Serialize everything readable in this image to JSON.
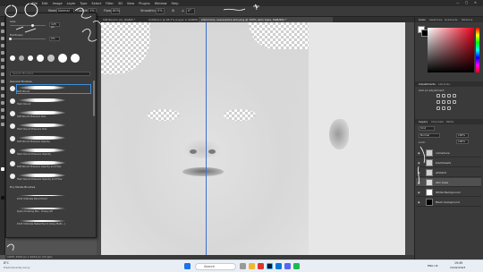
{
  "menu": [
    "File",
    "Edit",
    "Image",
    "Layer",
    "Type",
    "Select",
    "Filter",
    "3D",
    "View",
    "Plugins",
    "Window",
    "Help"
  ],
  "window_controls": [
    "—",
    "□",
    "✕"
  ],
  "options_bar": {
    "mode_label": "Mode:",
    "mode_value": "Normal",
    "opacity_label": "Opacity:",
    "opacity_value": "1%",
    "flow_label": "Flow:",
    "flow_value": "60%",
    "smoothing_label": "Smoothing:",
    "smoothing_value": "0%",
    "angle_value": "0°"
  },
  "doc_tabs": [
    {
      "label": "SIM Boom1 (C), RGB/8 *"
    },
    {
      "label": "Untitled-1 @ 66,7% (Layer 2, RGB/8) *"
    },
    {
      "label": "shimmerly overexplore skin.png @ 100% (skin base, RGB/8#) *"
    }
  ],
  "brush_panel": {
    "size_label": "Size:",
    "size_value": "125 px",
    "hardness_label": "Hardness:",
    "hardness_value": "0%",
    "search_placeholder": "Search Brushes",
    "general_header": "General Brushes",
    "brushes": [
      {
        "name": "Soft Round"
      },
      {
        "name": "Hard Round"
      },
      {
        "name": "Soft Round Pressure Size"
      },
      {
        "name": "Hard Round Pressure Size"
      },
      {
        "name": "Soft Round Pressure Opacity"
      },
      {
        "name": "Hard Round Pressure Opacity"
      },
      {
        "name": "Soft Round Pressure Opacity and Flow"
      },
      {
        "name": "Hard Round Pressure Opacity and Flow"
      }
    ],
    "dry_header": "Dry Media Brushes",
    "dry_brushes": [
      {
        "name": "KYLE Ultimate Pencil Hard"
      },
      {
        "name": "Kyle's Drawing Box - Heavy Gfl"
      },
      {
        "name": "KYLE Ultimate Pastel Pencil (Grey Multi...)"
      }
    ]
  },
  "status_bar": "100%   1024 px x 1024 px (72 ppi)",
  "right_panels": {
    "color_tabs": [
      "Color",
      "Swatches",
      "Gradients",
      "Patterns"
    ],
    "adjust_tabs": [
      "Adjustments",
      "Libraries"
    ],
    "adjust_label": "Add an adjustment",
    "layers_tabs": [
      "Layers",
      "Channels",
      "Paths"
    ],
    "kind_label": "Kind",
    "blend_mode": "Normal",
    "opacity_value": "100%",
    "lock_label": "Lock:",
    "fill_value": "100%",
    "layers": [
      {
        "name": "comedone",
        "selected": false
      },
      {
        "name": "blackheads",
        "selected": false
      },
      {
        "name": "whitehd",
        "selected": false
      },
      {
        "name": "skin base",
        "selected": true
      },
      {
        "name": "White Background",
        "selected": false
      },
      {
        "name": "Black background",
        "selected": false
      }
    ],
    "foreground_color": "#ffffff",
    "background_color": "#000000"
  },
  "taskbar": {
    "weather_temp": "8°C",
    "weather_text": "Predominantly sunny",
    "search_placeholder": "Search",
    "lang": "ENG UK",
    "time": "19:49",
    "date": "24/02/2023"
  }
}
